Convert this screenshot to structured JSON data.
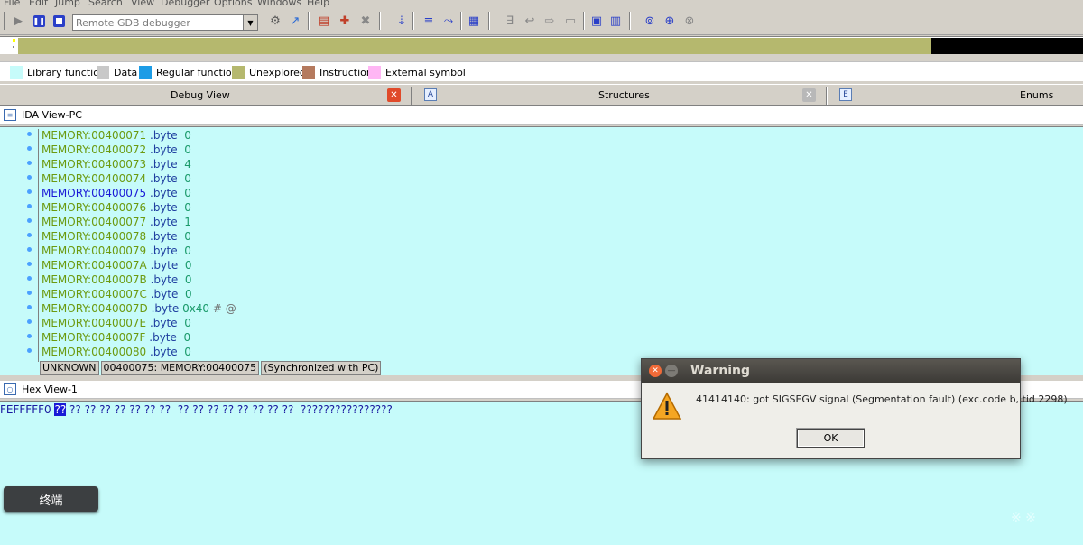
{
  "menu": [
    "File",
    "Edit",
    "Jump",
    "Search",
    "View",
    "Debugger",
    "Options",
    "Windows",
    "Help"
  ],
  "toolbar": {
    "debugger_select": "Remote GDB debugger"
  },
  "legend": [
    {
      "label": "Library function",
      "color": "#c6fbfa"
    },
    {
      "label": "Data",
      "color": "#c8c8c8"
    },
    {
      "label": "Regular function",
      "color": "#1c9ce6"
    },
    {
      "label": "Unexplored",
      "color": "#b5b86e"
    },
    {
      "label": "Instruction",
      "color": "#b57a5e"
    },
    {
      "label": "External symbol",
      "color": "#ffb6f4"
    }
  ],
  "tabs": {
    "debug_view": "Debug View",
    "structures": "Structures",
    "enums": "Enums"
  },
  "ida_view": {
    "title": "IDA View-PC",
    "lines": [
      {
        "addr": "MEMORY:00400071",
        "op": ".byte",
        "val": "0",
        "cmt": ""
      },
      {
        "addr": "MEMORY:00400072",
        "op": ".byte",
        "val": "0",
        "cmt": ""
      },
      {
        "addr": "MEMORY:00400073",
        "op": ".byte",
        "val": "4",
        "cmt": ""
      },
      {
        "addr": "MEMORY:00400074",
        "op": ".byte",
        "val": "0",
        "cmt": ""
      },
      {
        "addr": "MEMORY:00400075",
        "op": ".byte",
        "val": "0",
        "cmt": ""
      },
      {
        "addr": "MEMORY:00400076",
        "op": ".byte",
        "val": "0",
        "cmt": ""
      },
      {
        "addr": "MEMORY:00400077",
        "op": ".byte",
        "val": "1",
        "cmt": ""
      },
      {
        "addr": "MEMORY:00400078",
        "op": ".byte",
        "val": "0",
        "cmt": ""
      },
      {
        "addr": "MEMORY:00400079",
        "op": ".byte",
        "val": "0",
        "cmt": ""
      },
      {
        "addr": "MEMORY:0040007A",
        "op": ".byte",
        "val": "0",
        "cmt": ""
      },
      {
        "addr": "MEMORY:0040007B",
        "op": ".byte",
        "val": "0",
        "cmt": ""
      },
      {
        "addr": "MEMORY:0040007C",
        "op": ".byte",
        "val": "0",
        "cmt": ""
      },
      {
        "addr": "MEMORY:0040007D",
        "op": ".byte",
        "val": "0x40",
        "cmt": "# @"
      },
      {
        "addr": "MEMORY:0040007E",
        "op": ".byte",
        "val": "0",
        "cmt": ""
      },
      {
        "addr": "MEMORY:0040007F",
        "op": ".byte",
        "val": "0",
        "cmt": ""
      },
      {
        "addr": "MEMORY:00400080",
        "op": ".byte",
        "val": "0",
        "cmt": ""
      }
    ],
    "status": [
      "UNKNOWN",
      "00400075: MEMORY:00400075",
      "(Synchronized with PC)"
    ]
  },
  "hex_view": {
    "title": "Hex View-1",
    "addr": "FEFFFFF0",
    "first_byte": "??",
    "bytes_rest": " ?? ?? ?? ?? ?? ?? ??  ?? ?? ?? ?? ?? ?? ?? ??  ????????????????"
  },
  "terminal_button": "终端",
  "dialog": {
    "title": "Warning",
    "message": "41414140: got SIGSEGV signal (Segmentation fault) (exc.code b, tid 2298)",
    "ok_label": "OK"
  },
  "watermark": "※ ※"
}
